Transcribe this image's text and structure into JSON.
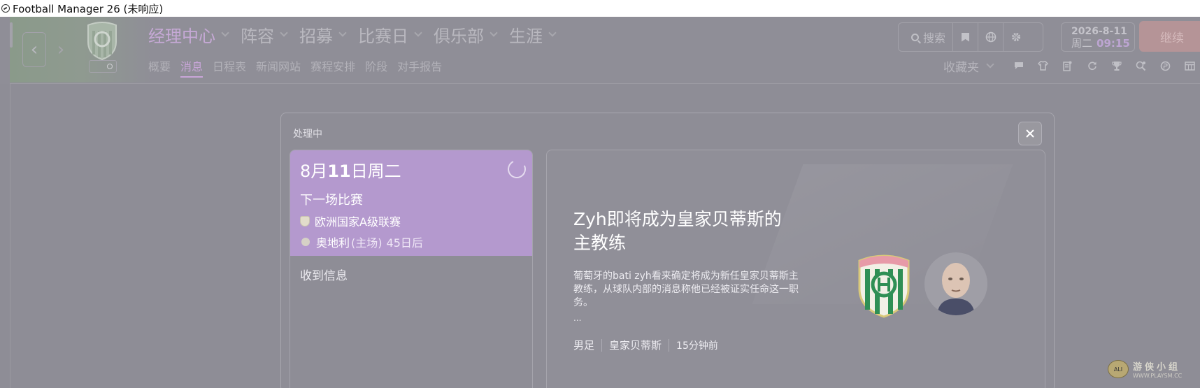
{
  "window": {
    "title": "Football Manager 26 (未响应)"
  },
  "header": {
    "main_menu": [
      {
        "label": "经理中心",
        "active": true
      },
      {
        "label": "阵容",
        "active": false
      },
      {
        "label": "招募",
        "active": false
      },
      {
        "label": "比赛日",
        "active": false
      },
      {
        "label": "俱乐部",
        "active": false
      },
      {
        "label": "生涯",
        "active": false
      }
    ],
    "sub_menu": [
      {
        "label": "概要",
        "active": false
      },
      {
        "label": "消息",
        "active": true
      },
      {
        "label": "日程表",
        "active": false
      },
      {
        "label": "新闻网站",
        "active": false
      },
      {
        "label": "赛程安排",
        "active": false
      },
      {
        "label": "阶段",
        "active": false
      },
      {
        "label": "对手报告",
        "active": false
      }
    ],
    "search_label": "搜索",
    "tool_icons": [
      "bookmark-icon",
      "globe-icon",
      "gear-icon"
    ],
    "date": "2026-8-11",
    "weekday": "周二",
    "time": "09:15",
    "continue_label": "继续",
    "favorites_label": "收藏夹",
    "quick_icons": [
      "chat-icon",
      "shirt-icon",
      "clipboard-icon",
      "refresh-icon",
      "trophy-icon",
      "scout-icon",
      "finance-icon",
      "calendar-icon"
    ]
  },
  "colors": {
    "accent_purple": "#b499ce",
    "continue_red": "#b59497",
    "background": "#8e8d96"
  },
  "dialog": {
    "title": "处理中",
    "next_match": {
      "date_day": "8月",
      "date_num": "11",
      "date_rest": "日周二",
      "label": "下一场比赛",
      "competition": "欧洲国家A级联赛",
      "opponent": "奥地利",
      "venue": "(主场)",
      "countdown": "45日后"
    },
    "inbox_label": "收到信息",
    "news": {
      "headline": "Zyh即将成为皇家贝蒂斯的主教练",
      "body": "葡萄牙的bati zyh看来确定将成为新任皇家贝蒂斯主教练，从球队内部的消息称他已经被证实任命这一职务。",
      "ellipsis": "...",
      "meta": [
        "男足",
        "皇家贝蒂斯",
        "15分钟前"
      ]
    }
  },
  "watermark": {
    "text": "游侠小组",
    "url": "WWW.PLAYSM.CC"
  }
}
